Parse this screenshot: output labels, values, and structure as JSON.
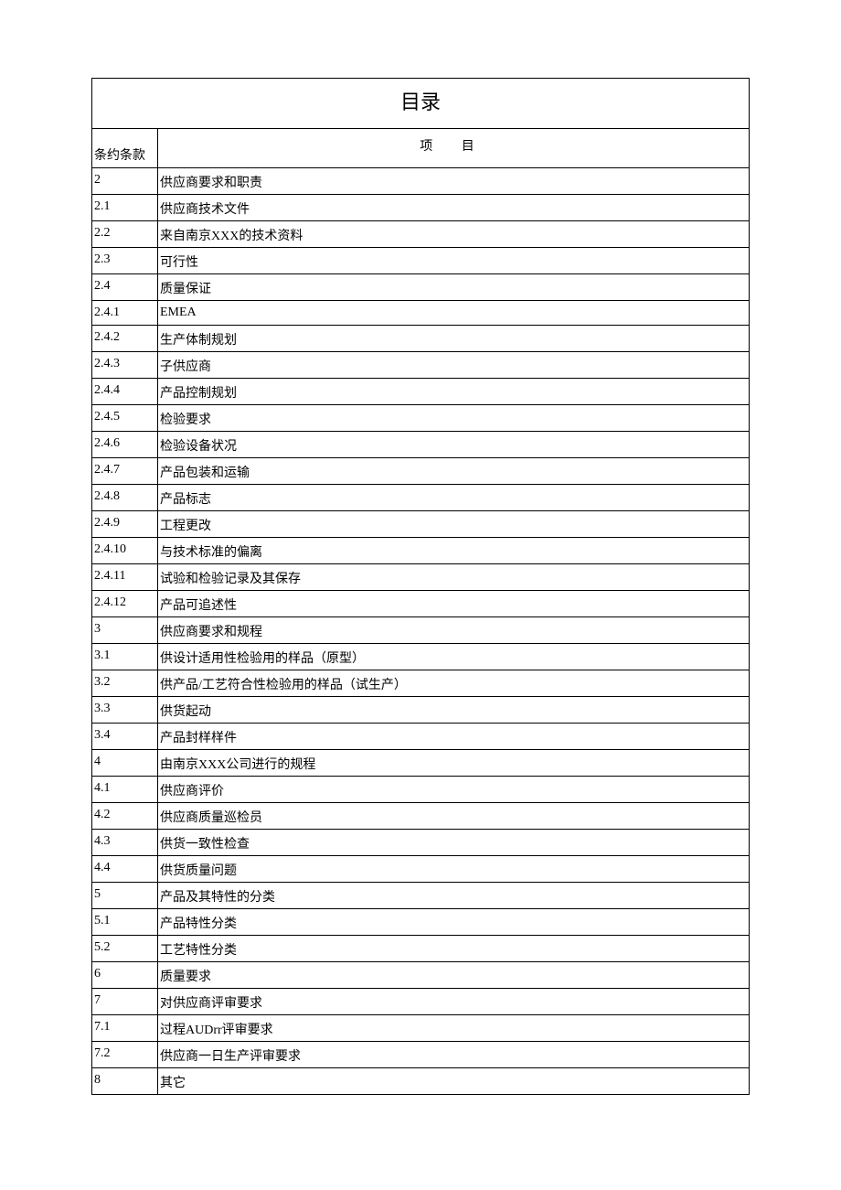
{
  "title": "目录",
  "header": {
    "col1": "条约条款",
    "col2": "项 目"
  },
  "rows": [
    {
      "num": "2",
      "item": "供应商要求和职责"
    },
    {
      "num": "2.1",
      "item": "供应商技术文件"
    },
    {
      "num": "2.2",
      "item": "来自南京XXX的技术资料"
    },
    {
      "num": "2.3",
      "item": "可行性"
    },
    {
      "num": "2.4",
      "item": "质量保证"
    },
    {
      "num": "2.4.1",
      "item": "EMEA"
    },
    {
      "num": "2.4.2",
      "item": "生产体制规划"
    },
    {
      "num": "2.4.3",
      "item": "子供应商"
    },
    {
      "num": "2.4.4",
      "item": "产品控制规划"
    },
    {
      "num": "2.4.5",
      "item": "检验要求"
    },
    {
      "num": "2.4.6",
      "item": "检验设备状况"
    },
    {
      "num": "2.4.7",
      "item": "产品包装和运输"
    },
    {
      "num": "2.4.8",
      "item": "产品标志"
    },
    {
      "num": "2.4.9",
      "item": "工程更改"
    },
    {
      "num": "2.4.10",
      "item": "与技术标准的偏离"
    },
    {
      "num": "2.4.11",
      "item": "试验和检验记录及其保存"
    },
    {
      "num": "2.4.12",
      "item": "产品可追述性"
    },
    {
      "num": "3",
      "item": "供应商要求和规程"
    },
    {
      "num": "3.1",
      "item": "供设计适用性检验用的样品（原型）"
    },
    {
      "num": "3.2",
      "item": "供产品/工艺符合性检验用的样品（试生产）"
    },
    {
      "num": "3.3",
      "item": "供货起动"
    },
    {
      "num": "3.4",
      "item": "产品封样样件"
    },
    {
      "num": "4",
      "item": "由南京XXX公司进行的规程"
    },
    {
      "num": "4.1",
      "item": "供应商评价"
    },
    {
      "num": "4.2",
      "item": "供应商质量巡检员"
    },
    {
      "num": "4.3",
      "item": "供货一致性检查"
    },
    {
      "num": "4.4",
      "item": "供货质量问题"
    },
    {
      "num": "5",
      "item": "产品及其特性的分类"
    },
    {
      "num": "5.1",
      "item": "产品特性分类"
    },
    {
      "num": "5.2",
      "item": "工艺特性分类"
    },
    {
      "num": "6",
      "item": "质量要求"
    },
    {
      "num": "7",
      "item": "对供应商评审要求"
    },
    {
      "num": "7.1",
      "item": "过程AUDrr评审要求"
    },
    {
      "num": "7.2",
      "item": "供应商一日生产评审要求"
    },
    {
      "num": "8",
      "item": "其它"
    }
  ]
}
